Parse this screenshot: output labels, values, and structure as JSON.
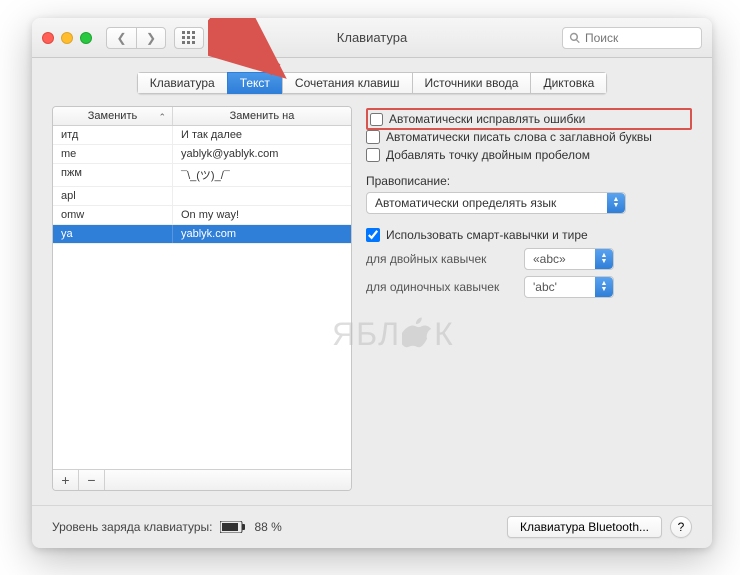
{
  "window": {
    "title": "Клавиатура"
  },
  "search": {
    "placeholder": "Поиск"
  },
  "tabs": [
    {
      "label": "Клавиатура",
      "active": false
    },
    {
      "label": "Текст",
      "active": true
    },
    {
      "label": "Сочетания клавиш",
      "active": false
    },
    {
      "label": "Источники ввода",
      "active": false
    },
    {
      "label": "Диктовка",
      "active": false
    }
  ],
  "table": {
    "headers": {
      "replace": "Заменить",
      "with": "Заменить на"
    },
    "rows": [
      {
        "a": "итд",
        "b": "И так далее"
      },
      {
        "a": "me",
        "b": "yablyk@yablyk.com"
      },
      {
        "a": "пжм",
        "b": "¯\\_(ツ)_/¯"
      },
      {
        "a": "apl",
        "b": ""
      },
      {
        "a": "omw",
        "b": "On my way!"
      },
      {
        "a": "ya",
        "b": "yablyk.com",
        "selected": true
      }
    ]
  },
  "checks": {
    "autocorrect": "Автоматически исправлять ошибки",
    "capitalize": "Автоматически писать слова с заглавной буквы",
    "doublespace": "Добавлять точку двойным пробелом",
    "smartquotes": "Использовать смарт-кавычки и тире"
  },
  "spelling": {
    "label": "Правописание:",
    "value": "Автоматически определять язык"
  },
  "quotes": {
    "double_label": "для двойных кавычек",
    "double_value": "«abc»",
    "single_label": "для одиночных кавычек",
    "single_value": "'abc'"
  },
  "footer": {
    "battery_label": "Уровень заряда клавиатуры:",
    "battery_pct": "88 %",
    "bluetooth_btn": "Клавиатура Bluetooth...",
    "help": "?"
  },
  "watermark": {
    "a": "ЯБЛ",
    "b": "К"
  }
}
